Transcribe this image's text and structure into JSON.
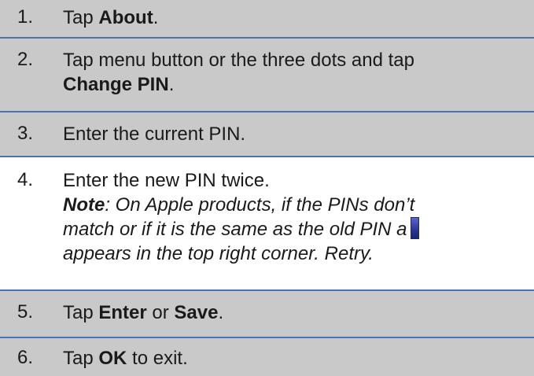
{
  "steps": [
    {
      "number": "1.",
      "before": "Tap ",
      "bold": "About",
      "after": "."
    },
    {
      "number": "2.",
      "line1": "Tap menu button or the three dots and tap",
      "bold": "Change PIN",
      "after": "."
    },
    {
      "number": "3.",
      "text": "Enter the current PIN."
    },
    {
      "number": "4.",
      "text": "Enter the new PIN twice.",
      "note_label": "Note",
      "note_line1": ":  On Apple products, if the PINs don’t",
      "note_line2": "match or if it is the same as the old PIN a",
      "note_line3": "appears in the top right corner.  Retry."
    },
    {
      "number": "5.",
      "before": "Tap ",
      "bold1": "Enter",
      "middle": " or ",
      "bold2": "Save",
      "after": "."
    },
    {
      "number": "6.",
      "before": "Tap ",
      "bold": "OK",
      "after": " to exit."
    }
  ],
  "colors": {
    "shaded_row": "#c9c9c9",
    "divider": "#4a72b8",
    "badge": "#2c3590"
  }
}
